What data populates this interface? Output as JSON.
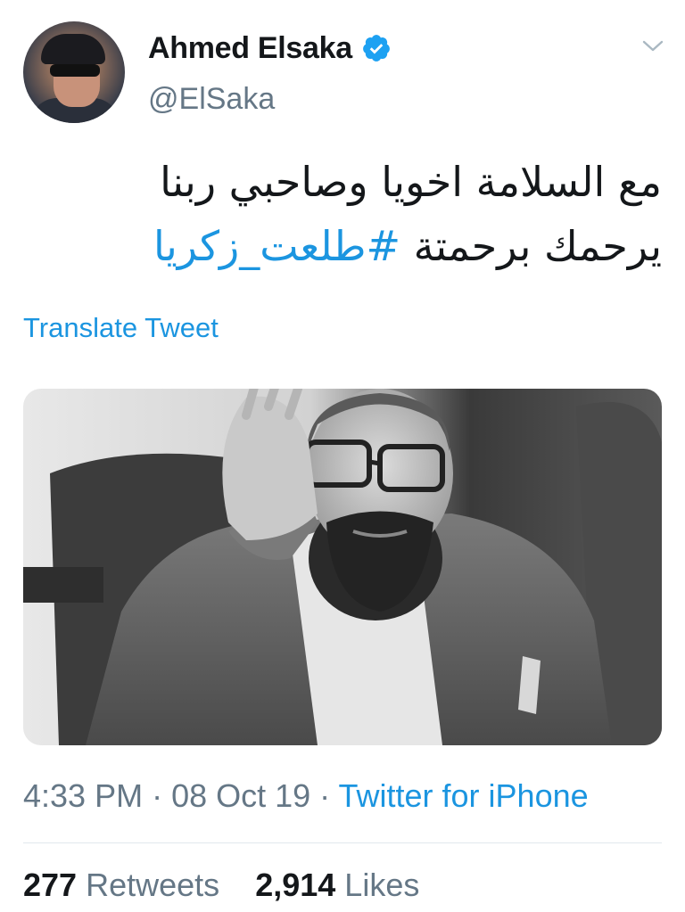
{
  "user": {
    "name": "Ahmed Elsaka",
    "handle": "@ElSaka",
    "verified": true
  },
  "tweet": {
    "text_line1": "مع السلامة اخويا وصاحبي ربنا",
    "text_line2_prefix": "يرحمك برحمتة ",
    "hashtag": "#طلعت_زكريا",
    "translate_label": "Translate Tweet"
  },
  "meta": {
    "time": "4:33 PM",
    "separator": " · ",
    "date": "08 Oct 19",
    "source": "Twitter for iPhone"
  },
  "stats": {
    "retweets_count": "277",
    "retweets_label": "Retweets",
    "likes_count": "2,914",
    "likes_label": "Likes"
  },
  "colors": {
    "link": "#1b95e0",
    "secondary_text": "#657786",
    "primary_text": "#14171a",
    "divider": "#e1e8ed"
  },
  "icons": {
    "verified": "verified-badge-icon",
    "menu": "chevron-down-icon"
  }
}
